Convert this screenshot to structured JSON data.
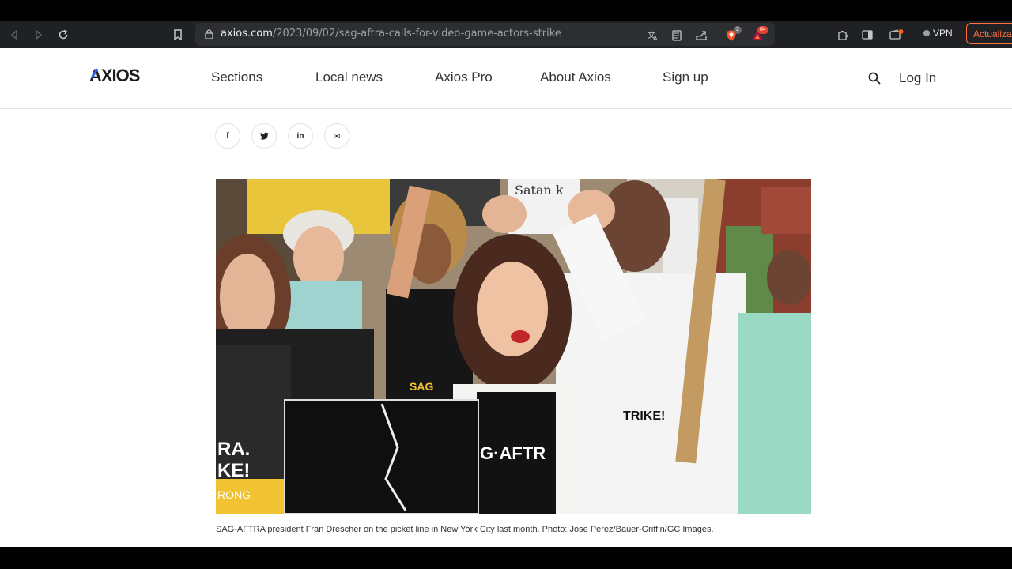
{
  "browser": {
    "url_domain": "axios.com",
    "url_path": "/2023/09/02/sag-aftra-calls-for-video-game-actors-strike",
    "shield_badge": "2",
    "rewards_badge": "84",
    "vpn_label": "VPN",
    "update_label": "Actualizar"
  },
  "header": {
    "logo": "AXIOS",
    "nav": [
      "Sections",
      "Local news",
      "Axios Pro",
      "About Axios",
      "Sign up"
    ],
    "login": "Log In"
  },
  "share": {
    "facebook": "f",
    "twitter": "t",
    "linkedin": "in",
    "email": "✉"
  },
  "photo_text": {
    "sign_left_1": "RA.",
    "sign_left_2": "KE!",
    "sign_left_3": "RONG",
    "shirt": "G·AFTR",
    "sign_right": "TRIKE!",
    "banner_top": "Satan k",
    "sag_shirt": "SAG"
  },
  "caption": "SAG-AFTRA president Fran Drescher on the picket line in New York City last month. Photo: Jose Perez/Bauer-Griffin/GC Images."
}
